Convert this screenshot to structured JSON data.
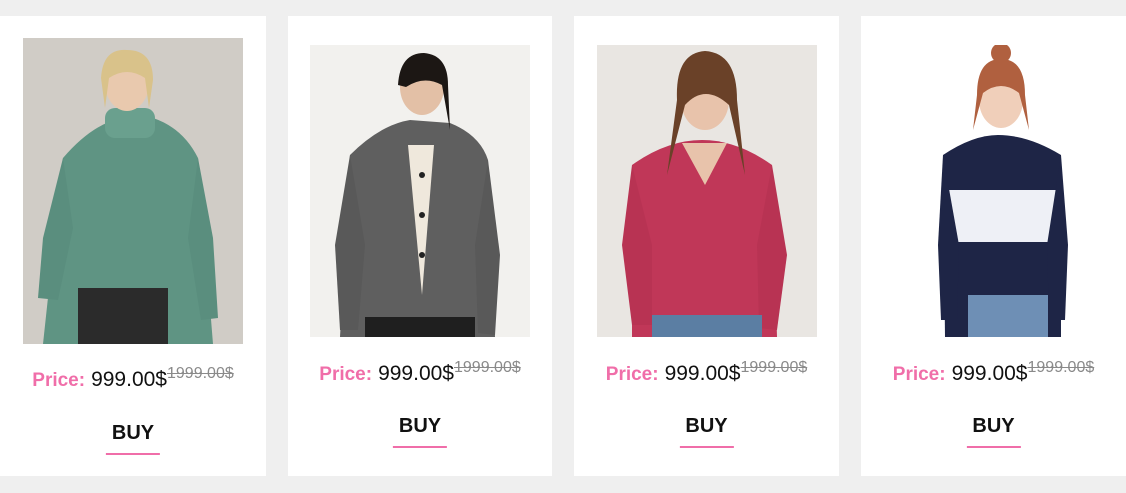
{
  "products": [
    {
      "price_label": "Price:",
      "price": "999.00$",
      "old_price": "1999.00$",
      "buy_label": "BUY",
      "image": "green-turtleneck-sweater-photo"
    },
    {
      "price_label": "Price:",
      "price": "999.00$",
      "old_price": "1999.00$",
      "buy_label": "BUY",
      "image": "grey-knit-cardigan-photo"
    },
    {
      "price_label": "Price:",
      "price": "999.00$",
      "old_price": "1999.00$",
      "buy_label": "BUY",
      "image": "red-vneck-sweater-photo"
    },
    {
      "price_label": "Price:",
      "price": "999.00$",
      "old_price": "1999.00$",
      "buy_label": "BUY",
      "image": "navy-white-striped-top-photo"
    }
  ],
  "colors": {
    "accent": "#f06ea9",
    "page_bg": "#efefef",
    "card_bg": "#ffffff",
    "old_price": "#8a8a8a"
  }
}
